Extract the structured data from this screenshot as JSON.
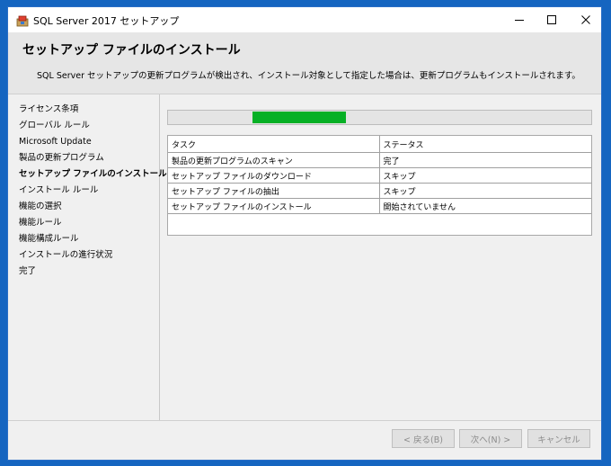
{
  "window": {
    "title": "SQL Server 2017 セットアップ",
    "minimize_glyph": "—",
    "maximize_glyph": "☐",
    "close_glyph": "✕"
  },
  "header": {
    "title": "セットアップ ファイルのインストール",
    "description": "SQL Server セットアップの更新プログラムが検出され、インストール対象として指定した場合は、更新プログラムもインストールされます。"
  },
  "sidebar": {
    "items": [
      {
        "label": "ライセンス条項",
        "active": false
      },
      {
        "label": "グローバル ルール",
        "active": false
      },
      {
        "label": "Microsoft Update",
        "active": false
      },
      {
        "label": "製品の更新プログラム",
        "active": false
      },
      {
        "label": "セットアップ ファイルのインストール",
        "active": true
      },
      {
        "label": "インストール ルール",
        "active": false
      },
      {
        "label": "機能の選択",
        "active": false
      },
      {
        "label": "機能ルール",
        "active": false
      },
      {
        "label": "機能構成ルール",
        "active": false
      },
      {
        "label": "インストールの進行状況",
        "active": false
      },
      {
        "label": "完了",
        "active": false
      }
    ]
  },
  "progress": {
    "start_fraction": 0.2,
    "end_fraction": 0.42,
    "color": "#06b025"
  },
  "task_table": {
    "headers": [
      "タスク",
      "ステータス"
    ],
    "rows": [
      [
        "製品の更新プログラムのスキャン",
        "完了"
      ],
      [
        "セットアップ ファイルのダウンロード",
        "スキップ"
      ],
      [
        "セットアップ ファイルの抽出",
        "スキップ"
      ],
      [
        "セットアップ ファイルのインストール",
        "開始されていません"
      ]
    ]
  },
  "footer": {
    "back_label": "< 戻る(B)",
    "next_label": "次へ(N) >",
    "cancel_label": "キャンセル"
  },
  "colors": {
    "desktop": "#1565c0",
    "window_border": "#2b6fc7",
    "header_bg": "#e6e6e6"
  },
  "icons": {
    "app": "sql-server-setup-icon",
    "minimize": "minimize-icon",
    "maximize": "maximize-icon",
    "close": "close-icon"
  }
}
